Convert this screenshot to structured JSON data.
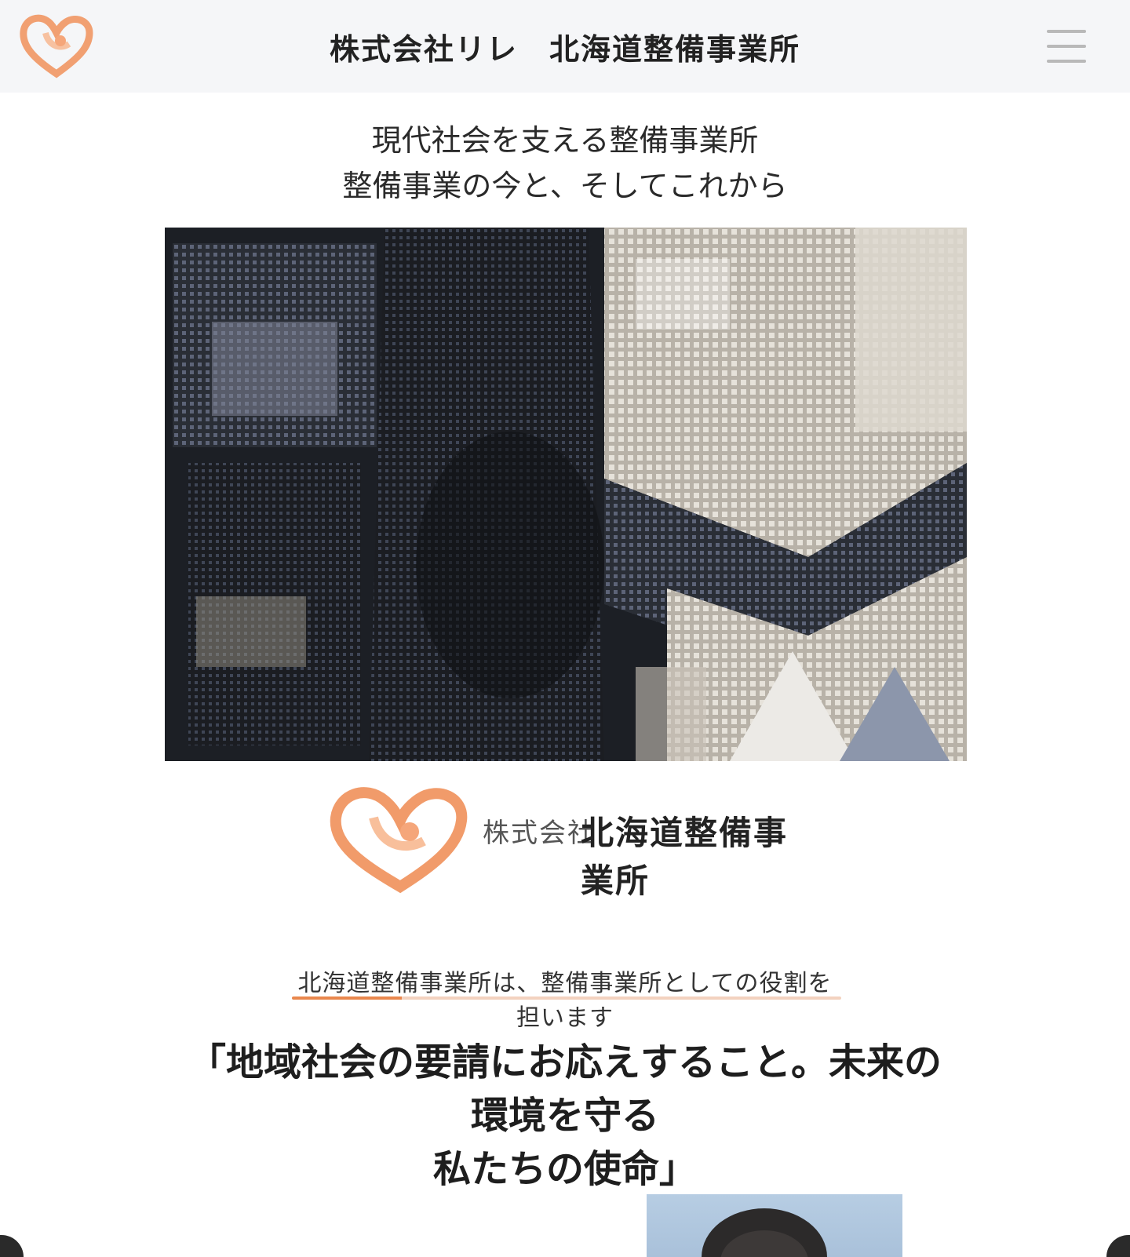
{
  "header": {
    "title": "株式会社リレ　北海道整備事業所",
    "menu_icon": "hamburger-menu-icon",
    "logo_icon": "heart-logo-icon"
  },
  "hero": {
    "title_line1": "現代社会を支える整備事業所",
    "title_line2": "整備事業の今と、そしてこれから",
    "photo_icon": "city-aerial-photo"
  },
  "brand": {
    "logo_icon": "heart-logo-icon",
    "kind": "株式会社",
    "name": "北海道整備事業所"
  },
  "section": {
    "lead": "北海道整備事業所は、整備事業所としての役割を担います",
    "message_line1": "「地域社会の要請にお応えすること。未来の環境を守る",
    "message_line2": "私たちの使命」"
  },
  "colors": {
    "accent": "#e9874d",
    "header_bg": "#f5f6f8",
    "text": "#1e1e1e"
  }
}
